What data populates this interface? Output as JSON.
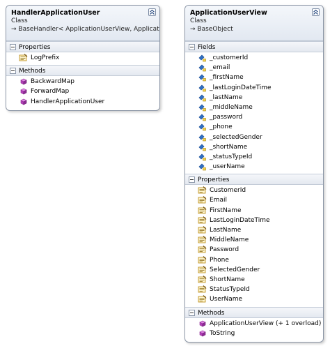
{
  "classes": [
    {
      "name": "HandlerApplicationUser",
      "kind": "Class",
      "base": "→ BaseHandler< ApplicationUserView, ApplicationUser>",
      "sections": [
        {
          "title": "Properties",
          "member_icon": "property-icon",
          "members": [
            "LogPrefix"
          ]
        },
        {
          "title": "Methods",
          "member_icon": "method-icon",
          "members": [
            "BackwardMap",
            "ForwardMap",
            "HandlerApplicationUser"
          ]
        }
      ]
    },
    {
      "name": "ApplicationUserView",
      "kind": "Class",
      "base": "→ BaseObject",
      "sections": [
        {
          "title": "Fields",
          "member_icon": "field-icon",
          "members": [
            "_customerId",
            "_email",
            "_firstName",
            "_lastLoginDateTime",
            "_lastName",
            "_middleName",
            "_password",
            "_phone",
            "_selectedGender",
            "_shortName",
            "_statusTypeId",
            "_userName"
          ]
        },
        {
          "title": "Properties",
          "member_icon": "property-icon",
          "members": [
            "CustomerId",
            "Email",
            "FirstName",
            "LastLoginDateTime",
            "LastName",
            "MiddleName",
            "Password",
            "Phone",
            "SelectedGender",
            "ShortName",
            "StatusTypeId",
            "UserName"
          ]
        },
        {
          "title": "Methods",
          "member_icon": "method-icon",
          "members": [
            "ApplicationUserView (+ 1 overload)",
            "ToString"
          ]
        }
      ]
    }
  ],
  "colors": {
    "border": "#8c96a6",
    "header_bg": "#e2e8f1",
    "field_icon": "#2f6fc4",
    "method_icon": "#b23fb8",
    "property_icon": "#d9a520"
  }
}
